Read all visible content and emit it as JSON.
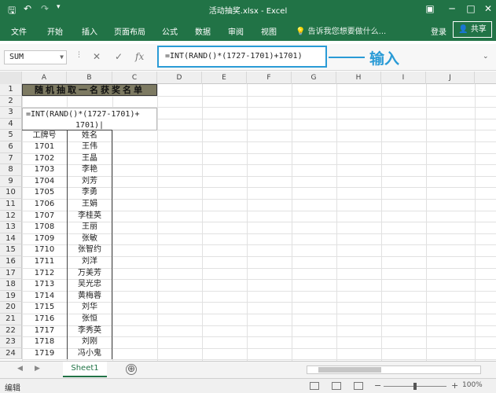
{
  "window": {
    "title": "活动抽奖.xlsx - Excel",
    "undo_icon": "undo-icon",
    "redo_icon": "redo-icon",
    "save_icon": "save-icon"
  },
  "ribbon": {
    "tabs": [
      "文件",
      "开始",
      "插入",
      "页面布局",
      "公式",
      "数据",
      "审阅",
      "视图"
    ],
    "tell_me": "告诉我您想要做什么...",
    "login": "登录",
    "share": "共享"
  },
  "formula_bar": {
    "name_box": "SUM",
    "formula": "=INT(RAND()*(1727-1701)+1701)",
    "annotation": "输入",
    "cancel_icon": "✕",
    "enter_icon": "✓",
    "fx_icon": "fx"
  },
  "columns": [
    "A",
    "B",
    "C",
    "D",
    "E",
    "F",
    "G",
    "H",
    "I",
    "J"
  ],
  "rows": [
    "1",
    "2",
    "3",
    "4",
    "5",
    "6",
    "7",
    "8",
    "9",
    "10",
    "11",
    "12",
    "13",
    "14",
    "15",
    "16",
    "17",
    "18",
    "19",
    "20",
    "21",
    "22",
    "23",
    "24"
  ],
  "sheet": {
    "title_cell": "随机抽取一名获奖名单",
    "edit_line1": "=INT(RAND()*(1727-1701)+",
    "edit_line2": "1701)|",
    "header_a": "工牌号",
    "header_b": "姓名",
    "ids": [
      "1701",
      "1702",
      "1703",
      "1704",
      "1705",
      "1706",
      "1707",
      "1708",
      "1709",
      "1710",
      "1711",
      "1712",
      "1713",
      "1714",
      "1715",
      "1716",
      "1717",
      "1718",
      "1719"
    ],
    "names": [
      "王伟",
      "王晶",
      "李艳",
      "刘芳",
      "李勇",
      "王娟",
      "李桂英",
      "王丽",
      "张敏",
      "张智约",
      "刘洋",
      "万美芳",
      "吴光忠",
      "黄梅蓉",
      "刘华",
      "张恒",
      "李秀英",
      "刘刚",
      "冯小鬼"
    ]
  },
  "tabs_bar": {
    "sheet_name": "Sheet1",
    "add_icon": "⊕"
  },
  "status": {
    "text": "编辑",
    "zoom": "100%"
  },
  "colors": {
    "excel_green": "#217346",
    "annotation_blue": "#2a9bd6",
    "title_fill": "#7d7a62"
  }
}
